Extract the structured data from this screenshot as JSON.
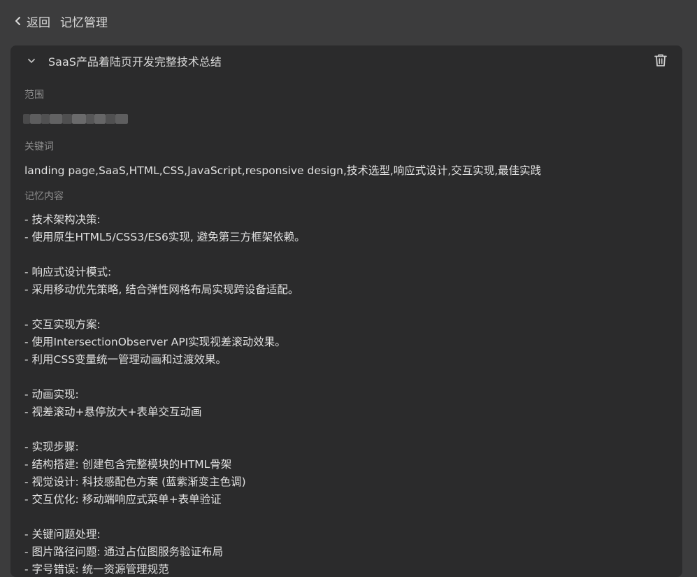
{
  "header": {
    "back_label": "返回",
    "title": "记忆管理"
  },
  "memory": {
    "title": "SaaS产品着陆页开发完整技术总结",
    "scope_label": "范围",
    "keywords_label": "关键词",
    "keywords": "landing page,SaaS,HTML,CSS,JavaScript,responsive design,技术选型,响应式设计,交互实现,最佳实践",
    "content_label": "记忆内容",
    "content_lines": [
      "- 技术架构决策:",
      "- 使用原生HTML5/CSS3/ES6实现, 避免第三方框架依赖。",
      "",
      "- 响应式设计模式:",
      "- 采用移动优先策略, 结合弹性网格布局实现跨设备适配。",
      "",
      "- 交互实现方案:",
      "- 使用IntersectionObserver API实现视差滚动效果。",
      "- 利用CSS变量统一管理动画和过渡效果。",
      "",
      "- 动画实现:",
      "- 视差滚动+悬停放大+表单交互动画",
      "",
      "- 实现步骤:",
      "- 结构搭建: 创建包含完整模块的HTML骨架",
      "- 视觉设计: 科技感配色方案 (蓝紫渐变主色调)",
      "- 交互优化: 移动端响应式菜单+表单验证",
      "",
      "- 关键问题处理:",
      "- 图片路径问题: 通过占位图服务验证布局",
      "- 字号错误: 统一资源管理规范"
    ]
  },
  "icons": {
    "back": "chevron-left-icon",
    "collapse": "chevron-down-icon",
    "delete": "trash-icon"
  },
  "colors": {
    "page_bg": "#3c3c3d",
    "card_bg": "#2b2b2c",
    "text": "#e0e0e0",
    "label": "#8e8e8e"
  }
}
